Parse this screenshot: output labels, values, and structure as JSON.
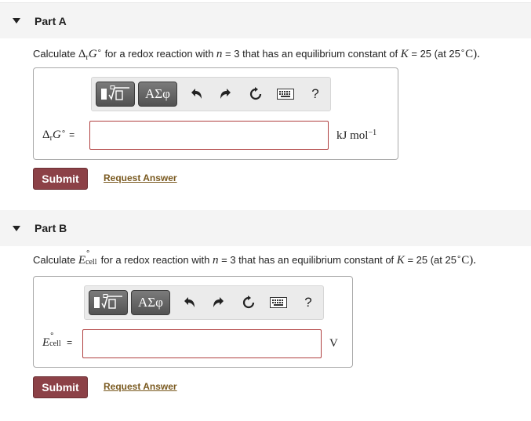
{
  "colors": {
    "header_bg": "#f4f4f4",
    "submit_bg": "#8c4147",
    "input_border": "#b04040",
    "link": "#7a5a20",
    "toolbar_button": "#5e5e5e"
  },
  "toolbar": {
    "templates_icon": "templates-icon",
    "greek_label": "ΑΣφ",
    "undo_icon": "undo-icon",
    "redo_icon": "redo-icon",
    "reset_icon": "reset-icon",
    "keyboard_icon": "keyboard-icon",
    "help_label": "?"
  },
  "part_a": {
    "title": "Part A",
    "question": {
      "prefix": "Calculate",
      "delta": "Δ",
      "delta_sub": "r",
      "symbol": "G",
      "symbol_sup": "∘",
      "middle": "for a redox reaction with",
      "n": "n",
      "n_value": "= 3 that has an equilibrium constant of",
      "k": "K",
      "k_value": "= 25 (at 25",
      "temp_unit": "∘",
      "temp_c": "C).",
      "close": ""
    },
    "lhs": {
      "delta": "Δ",
      "sub": "r",
      "symbol": "G",
      "sup": "∘",
      "eq": "="
    },
    "input_value": "",
    "unit": {
      "text": "kJ mol",
      "sup": "−1"
    },
    "submit_label": "Submit",
    "request_label": "Request Answer"
  },
  "part_b": {
    "title": "Part B",
    "question": {
      "prefix": "Calculate",
      "symbol": "E",
      "symbol_sup": "∘",
      "symbol_sub": "cell",
      "middle": "for a redox reaction with",
      "n": "n",
      "n_value": "= 3 that has an equilibrium constant of",
      "k": "K",
      "k_value": "= 25 (at 25",
      "temp_unit": "∘",
      "temp_c": "C)."
    },
    "lhs": {
      "symbol": "E",
      "sup": "∘",
      "sub": "cell",
      "eq": "="
    },
    "input_value": "",
    "unit": {
      "text": "V"
    },
    "submit_label": "Submit",
    "request_label": "Request Answer"
  }
}
